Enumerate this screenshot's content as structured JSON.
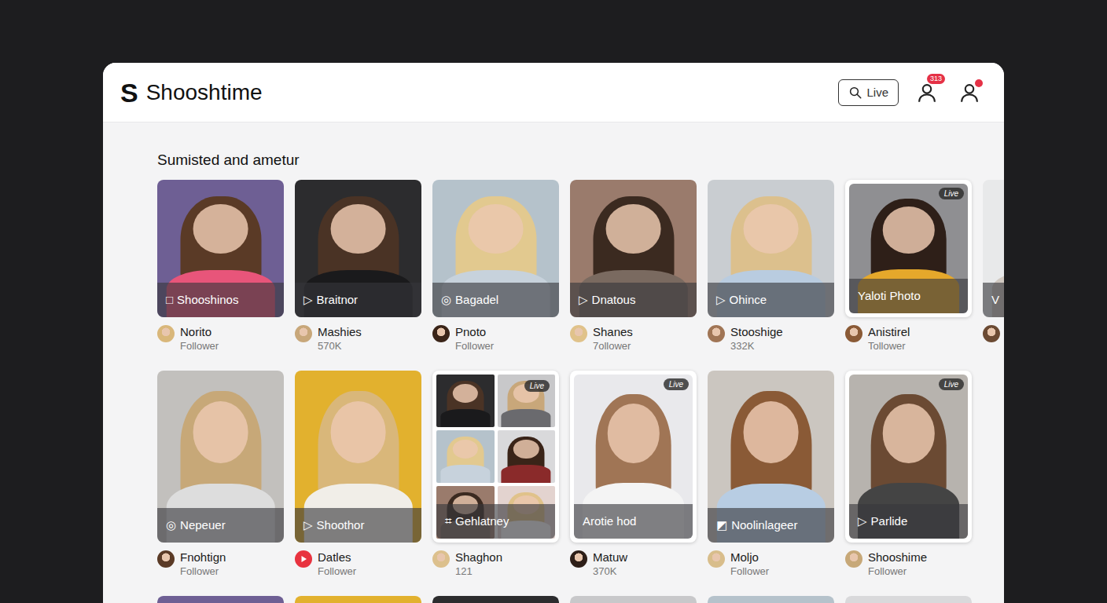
{
  "brand": {
    "mark": "S",
    "name": "Shooshtime"
  },
  "header": {
    "search_label": "Live",
    "notifications": {
      "badge": "313"
    },
    "profile": {
      "dot": true
    }
  },
  "section": {
    "title": "Sumisted and ametur"
  },
  "rows": [
    [
      {
        "kind": "photo",
        "icon": "□",
        "label": "Shooshinos",
        "name": "Norito",
        "sub": "Follower",
        "live": false,
        "avatar": "photo"
      },
      {
        "kind": "photo",
        "icon": "▷",
        "label": "Braitnor",
        "name": "Mashies",
        "sub": "570K",
        "live": false,
        "avatar": "photo"
      },
      {
        "kind": "photo",
        "icon": "◎",
        "label": "Bagadel",
        "name": "Pnoto",
        "sub": "Follower",
        "live": false,
        "avatar": "photo"
      },
      {
        "kind": "photo",
        "icon": "▷",
        "label": "Dnatous",
        "name": "Shanes",
        "sub": "7ollower",
        "live": false,
        "avatar": "photo"
      },
      {
        "kind": "photo",
        "icon": "▷",
        "label": "Ohince",
        "name": "Stooshige",
        "sub": "332K",
        "live": false,
        "avatar": "photo"
      },
      {
        "kind": "photo",
        "icon": "",
        "label": "Yaloti Photo",
        "name": "Anistirel",
        "sub": "Tollower",
        "live": true,
        "live_label": "Live",
        "avatar": "photo"
      },
      {
        "kind": "photo",
        "icon": "V",
        "label": "",
        "name": "",
        "sub": "",
        "live": false,
        "avatar": "photo"
      }
    ],
    [
      {
        "kind": "photo",
        "icon": "◎",
        "label": "Nepeuer",
        "name": "Fnohtign",
        "sub": "Follower",
        "live": false,
        "avatar": "photo"
      },
      {
        "kind": "photo",
        "icon": "▷",
        "label": "Shoothor",
        "name": "Datles",
        "sub": "Follower",
        "live": false,
        "avatar": "play"
      },
      {
        "kind": "collage",
        "icon": "⌗",
        "label": "Gehlatney",
        "name": "Shaghon",
        "sub": "121",
        "live": true,
        "live_label": "Live",
        "avatar": "photo"
      },
      {
        "kind": "photo",
        "icon": "",
        "label": "Arotie hod",
        "name": "Matuw",
        "sub": "370K",
        "live": true,
        "live_label": "Live",
        "avatar": "photo"
      },
      {
        "kind": "photo",
        "icon": "◩",
        "label": "Noolinlageer",
        "name": "Moljo",
        "sub": "Follower",
        "live": false,
        "avatar": "photo"
      },
      {
        "kind": "photo",
        "icon": "▷",
        "label": "Parlide",
        "name": "Shooshime",
        "sub": "Follower",
        "live": true,
        "live_label": "Live",
        "avatar": "photo"
      }
    ]
  ],
  "partial_row": [
    {
      "kind": "photo"
    },
    {
      "kind": "photo"
    },
    {
      "kind": "photo"
    },
    {
      "kind": "photo"
    },
    {
      "kind": "photo"
    },
    {
      "kind": "photo"
    }
  ]
}
